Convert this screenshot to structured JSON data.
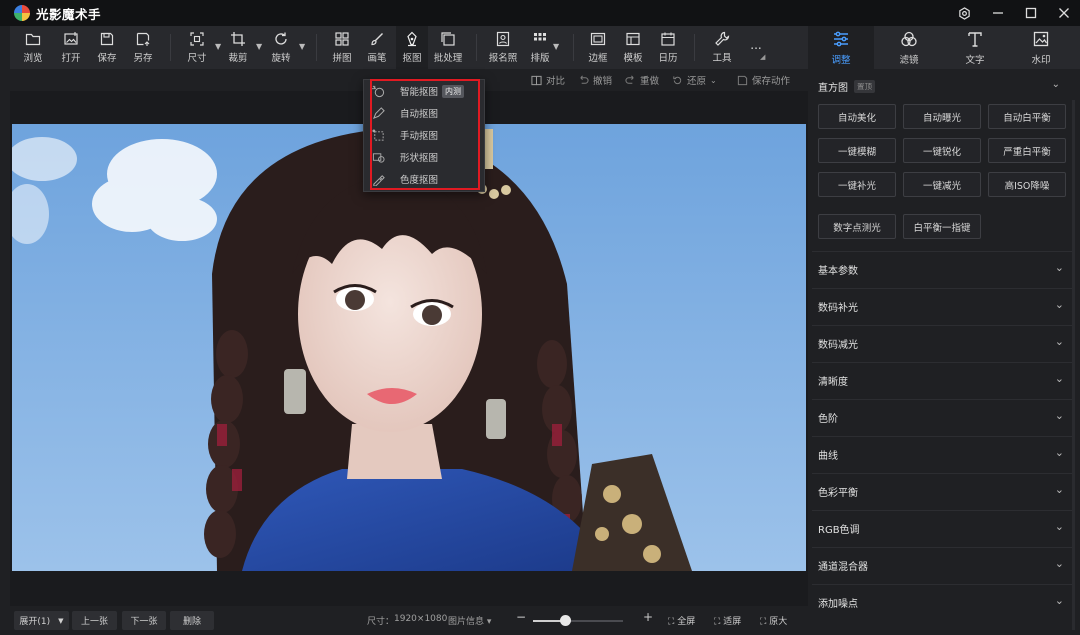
{
  "app": {
    "title": "光影魔术手"
  },
  "toolbar": {
    "items": [
      {
        "label": "浏览",
        "icon": "folder-icon"
      },
      {
        "label": "打开",
        "icon": "open-image-icon"
      },
      {
        "label": "保存",
        "icon": "save-icon"
      },
      {
        "label": "另存",
        "icon": "save-as-icon"
      },
      {
        "label": "尺寸",
        "icon": "resize-icon"
      },
      {
        "label": "裁剪",
        "icon": "crop-icon"
      },
      {
        "label": "旋转",
        "icon": "rotate-icon"
      },
      {
        "label": "拼图",
        "icon": "collage-icon"
      },
      {
        "label": "画笔",
        "icon": "brush-icon"
      },
      {
        "label": "抠图",
        "icon": "cutout-pen-icon"
      },
      {
        "label": "批处理",
        "icon": "batch-icon"
      },
      {
        "label": "报名照",
        "icon": "id-photo-icon"
      },
      {
        "label": "排版",
        "icon": "layout-icon"
      },
      {
        "label": "边框",
        "icon": "border-icon"
      },
      {
        "label": "模板",
        "icon": "template-icon"
      },
      {
        "label": "日历",
        "icon": "calendar-icon"
      },
      {
        "label": "工具",
        "icon": "tools-icon"
      },
      {
        "label": "...",
        "icon": "more-icon"
      }
    ]
  },
  "right_tabs": [
    {
      "label": "调整",
      "icon": "sliders-icon"
    },
    {
      "label": "滤镜",
      "icon": "filter-icon"
    },
    {
      "label": "文字",
      "icon": "text-icon"
    },
    {
      "label": "水印",
      "icon": "watermark-icon"
    }
  ],
  "subbar": {
    "compare": "对比",
    "undo": "撤销",
    "redo": "重做",
    "restore": "还原",
    "save_action": "保存动作"
  },
  "cutout_menu": {
    "items": [
      {
        "label": "智能抠图",
        "badge": "内测"
      },
      {
        "label": "自动抠图"
      },
      {
        "label": "手动抠图"
      },
      {
        "label": "形状抠图"
      },
      {
        "label": "色度抠图"
      }
    ]
  },
  "panel": {
    "histogram_label": "直方图",
    "histogram_badge": "置顶",
    "quick_buttons": [
      "自动美化",
      "自动曝光",
      "自动白平衡",
      "一键模糊",
      "一键锐化",
      "严重白平衡",
      "一键补光",
      "一键减光",
      "高ISO降噪",
      "数字点测光",
      "白平衡一指键"
    ],
    "sections": [
      "基本参数",
      "数码补光",
      "数码减光",
      "清晰度",
      "色阶",
      "曲线",
      "色彩平衡",
      "RGB色调",
      "通道混合器",
      "添加噪点"
    ]
  },
  "bottom": {
    "expand": "展开(1)",
    "prev": "上一张",
    "next": "下一张",
    "delete": "删除",
    "size_label": "尺寸：",
    "size_value": "1920×1080",
    "image_info": "图片信息",
    "fullscreen": "全屏",
    "fit": "适屏",
    "original": "原大",
    "zoom": 0.35
  }
}
